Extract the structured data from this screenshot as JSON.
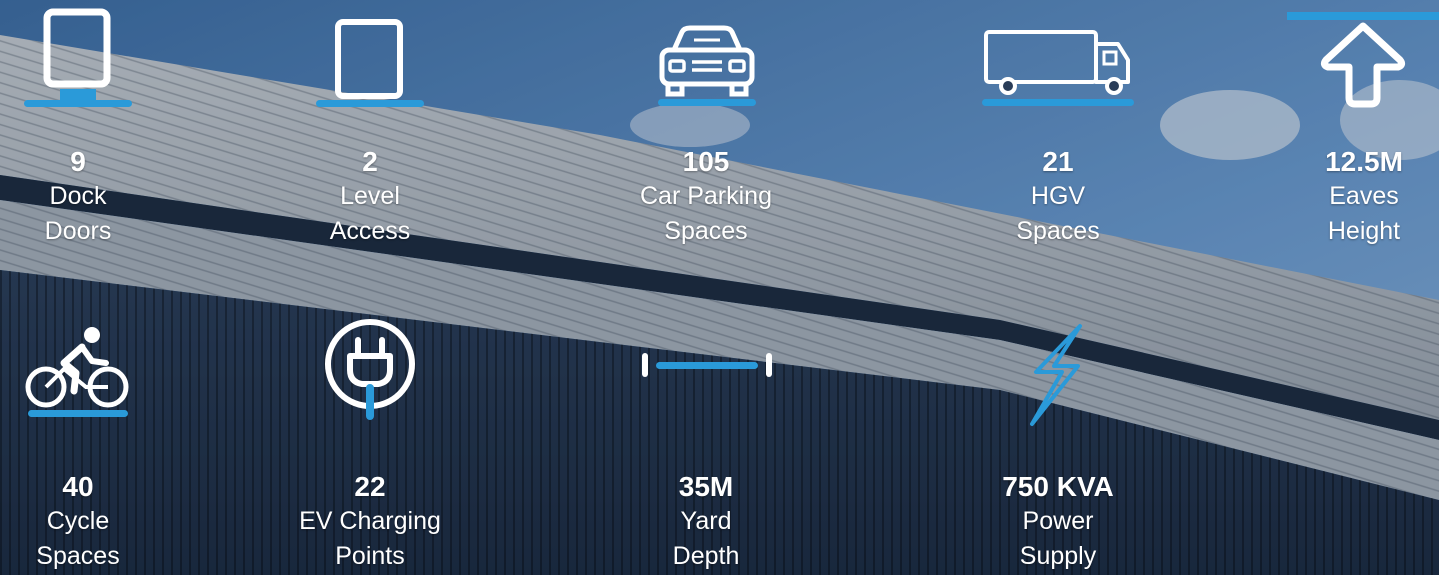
{
  "colors": {
    "accent": "#2a9ad9",
    "sky": "#5c8fc4",
    "cladding_light": "#c9ced4",
    "cladding_dark": "#22344f"
  },
  "features": [
    {
      "value": "9",
      "label1": "Dock",
      "label2": "Doors",
      "icon": "dock-door-icon"
    },
    {
      "value": "2",
      "label1": "Level",
      "label2": "Access",
      "icon": "level-door-icon"
    },
    {
      "value": "105",
      "label1": "Car Parking",
      "label2": "Spaces",
      "icon": "car-icon"
    },
    {
      "value": "21",
      "label1": "HGV",
      "label2": "Spaces",
      "icon": "truck-icon"
    },
    {
      "value": "12.5M",
      "label1": "Eaves",
      "label2": "Height",
      "icon": "arrow-up-icon"
    },
    {
      "value": "40",
      "label1": "Cycle",
      "label2": "Spaces",
      "icon": "cyclist-icon"
    },
    {
      "value": "22",
      "label1": "EV Charging",
      "label2": "Points",
      "icon": "ev-plug-icon"
    },
    {
      "value": "35M",
      "label1": "Yard",
      "label2": "Depth",
      "icon": "yard-depth-icon"
    },
    {
      "value": "750 KVA",
      "label1": "Power",
      "label2": "Supply",
      "icon": "lightning-bolt-icon"
    }
  ]
}
